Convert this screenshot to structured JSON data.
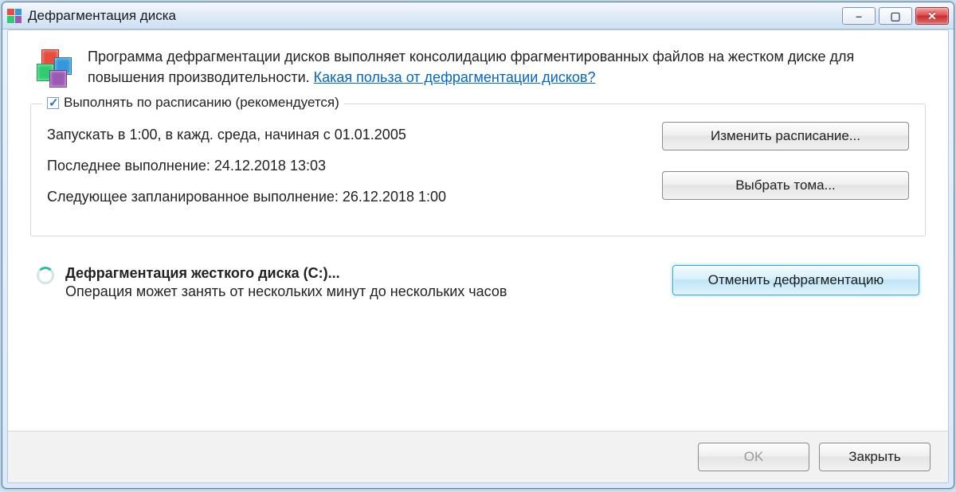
{
  "window": {
    "title": "Дефрагментация диска"
  },
  "intro": {
    "text": "Программа дефрагментации дисков выполняет консолидацию фрагментированных файлов на жестком диске для повышения производительности. ",
    "link": "Какая польза от дефрагментации дисков?"
  },
  "schedule": {
    "checkbox_label": "Выполнять по расписанию (рекомендуется)",
    "run_line": "Запускать в 1:00, в кажд. среда, начиная с 01.01.2005",
    "last_run": "Последнее выполнение: 24.12.2018 13:03",
    "next_run": "Следующее запланированное выполнение: 26.12.2018 1:00",
    "change_button": "Изменить расписание...",
    "volumes_button": "Выбрать тома..."
  },
  "status": {
    "title": "Дефрагментация жесткого диска (C:)...",
    "description": "Операция может занять от нескольких минут до нескольких часов",
    "cancel_button": "Отменить дефрагментацию"
  },
  "footer": {
    "ok": "OK",
    "close": "Закрыть"
  }
}
